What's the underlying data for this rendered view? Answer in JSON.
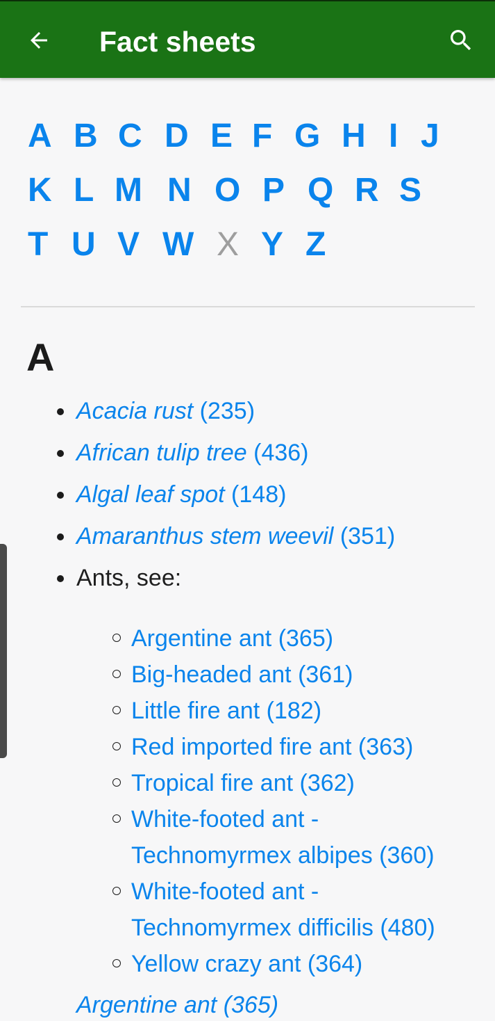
{
  "appbar": {
    "title": "Fact sheets",
    "back_icon": "arrow-back-icon",
    "search_icon": "search-icon",
    "color": "#1a7315"
  },
  "alphabet": {
    "rows": [
      [
        "A",
        "B",
        "C",
        "D",
        "E",
        "F",
        "G",
        "H",
        "I",
        "J"
      ],
      [
        "K",
        "L",
        "M",
        "N",
        "O",
        "P",
        "Q",
        "R",
        "S"
      ],
      [
        "T",
        "U",
        "V",
        "W",
        "X",
        "Y",
        "Z"
      ]
    ],
    "disabled": [
      "X"
    ],
    "link_color": "#0a84ec"
  },
  "section": {
    "heading": "A",
    "items": [
      {
        "name": "Acacia rust",
        "num": "(235)"
      },
      {
        "name": "African tulip tree",
        "num": "(436)"
      },
      {
        "name": "Algal leaf spot",
        "num": "(148)"
      },
      {
        "name": "Amaranthus stem weevil",
        "num": "(351)"
      },
      {
        "text": "Ants, see:"
      }
    ],
    "ants": [
      "Argentine ant (365)",
      "Big-headed ant (361)",
      "Little fire ant (182)",
      "Red imported fire ant (363)",
      "Tropical fire ant (362)",
      "White-footed ant - Technomyrmex albipes (360)",
      "White-footed ant - Technomyrmex difficilis (480)",
      "Yellow crazy ant (364)"
    ],
    "next_partial": "Argentine ant (365)"
  }
}
